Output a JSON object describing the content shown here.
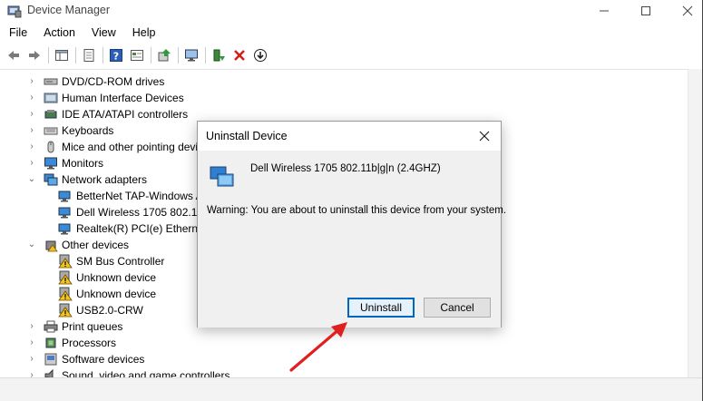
{
  "window": {
    "title": "Device Manager"
  },
  "menu": [
    "File",
    "Action",
    "View",
    "Help"
  ],
  "tree": [
    {
      "label": "DVD/CD-ROM drives",
      "level": 0,
      "state": "collapsed",
      "icon": "dvd-drive-icon"
    },
    {
      "label": "Human Interface Devices",
      "level": 0,
      "state": "collapsed",
      "icon": "hid-icon"
    },
    {
      "label": "IDE ATA/ATAPI controllers",
      "level": 0,
      "state": "collapsed",
      "icon": "ide-controller-icon"
    },
    {
      "label": "Keyboards",
      "level": 0,
      "state": "collapsed",
      "icon": "keyboard-icon"
    },
    {
      "label": "Mice and other pointing devi",
      "level": 0,
      "state": "collapsed",
      "icon": "mouse-icon"
    },
    {
      "label": "Monitors",
      "level": 0,
      "state": "collapsed",
      "icon": "monitor-icon"
    },
    {
      "label": "Network adapters",
      "level": 0,
      "state": "expanded",
      "icon": "network-adapter-icon"
    },
    {
      "label": "BetterNet TAP-Windows A",
      "level": 1,
      "state": "none",
      "icon": "network-adapter-icon"
    },
    {
      "label": "Dell Wireless 1705 802.11b",
      "level": 1,
      "state": "none",
      "icon": "network-adapter-icon"
    },
    {
      "label": "Realtek(R) PCI(e) Ethernet",
      "level": 1,
      "state": "none",
      "icon": "network-adapter-icon"
    },
    {
      "label": "Other devices",
      "level": 0,
      "state": "expanded",
      "icon": "other-devices-icon"
    },
    {
      "label": "SM Bus Controller",
      "level": 1,
      "state": "none",
      "icon": "warning-device-icon"
    },
    {
      "label": "Unknown device",
      "level": 1,
      "state": "none",
      "icon": "warning-device-icon"
    },
    {
      "label": "Unknown device",
      "level": 1,
      "state": "none",
      "icon": "warning-device-icon"
    },
    {
      "label": "USB2.0-CRW",
      "level": 1,
      "state": "none",
      "icon": "warning-device-icon"
    },
    {
      "label": "Print queues",
      "level": 0,
      "state": "collapsed",
      "icon": "printer-icon"
    },
    {
      "label": "Processors",
      "level": 0,
      "state": "collapsed",
      "icon": "processor-icon"
    },
    {
      "label": "Software devices",
      "level": 0,
      "state": "collapsed",
      "icon": "software-device-icon"
    },
    {
      "label": "Sound, video and game controllers",
      "level": 0,
      "state": "collapsed",
      "icon": "sound-icon"
    }
  ],
  "dialog": {
    "title": "Uninstall Device",
    "device_name": "Dell Wireless 1705 802.11b|g|n (2.4GHZ)",
    "warning": "Warning: You are about to uninstall this device from your system.",
    "uninstall_label": "Uninstall",
    "cancel_label": "Cancel"
  },
  "colors": {
    "accent": "#0067c0",
    "annotation_arrow": "#e02020"
  }
}
